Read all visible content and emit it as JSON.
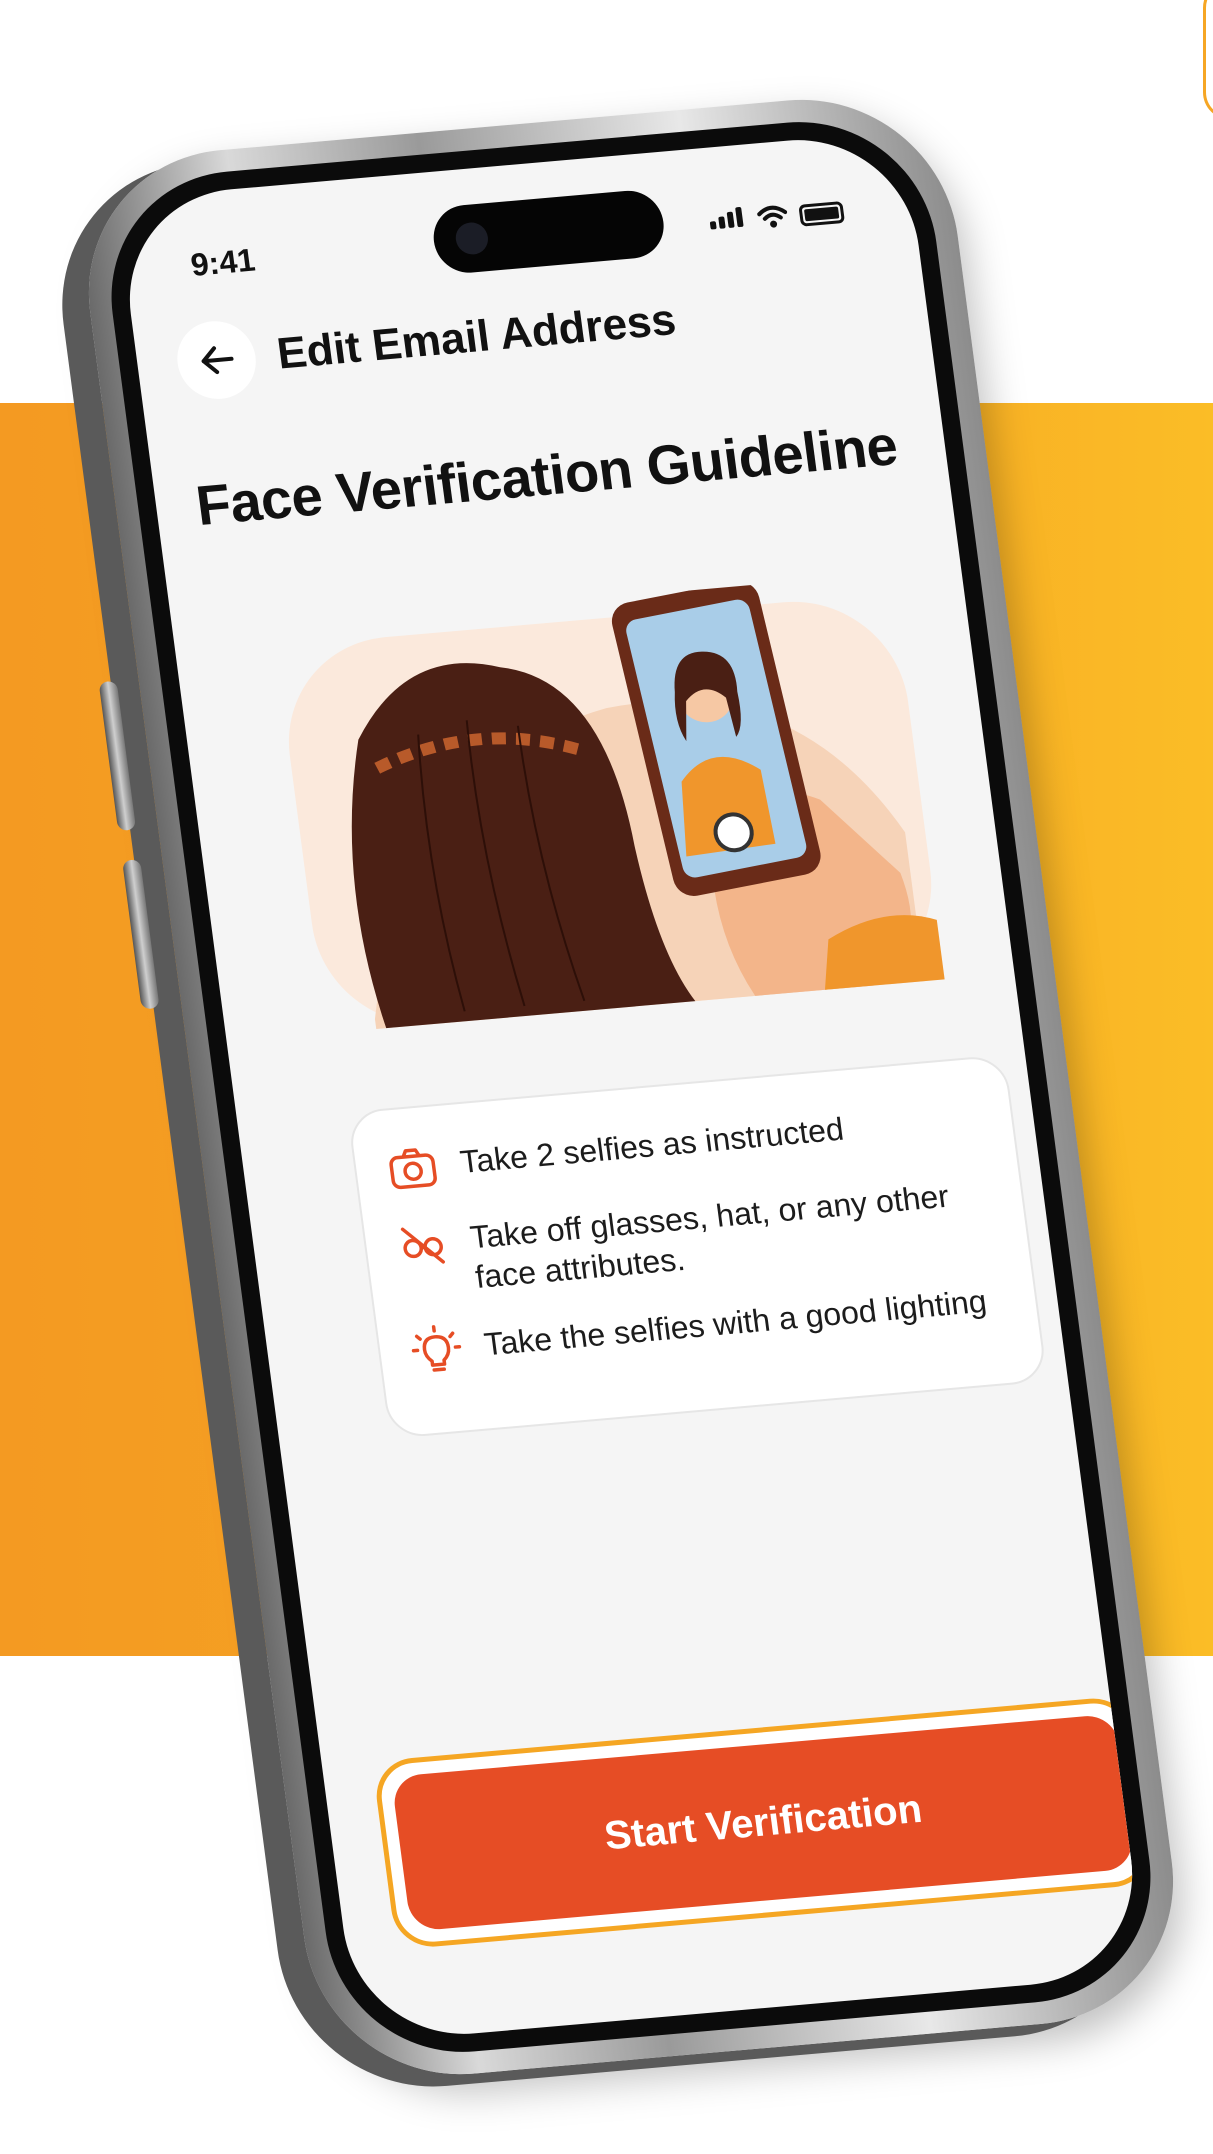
{
  "status_bar": {
    "time": "9:41"
  },
  "header": {
    "title": "Edit Email Address"
  },
  "page": {
    "title": "Face Verification Guideline"
  },
  "guidelines": [
    {
      "icon": "camera-icon",
      "text": "Take 2 selfies as instructed"
    },
    {
      "icon": "no-glasses-icon",
      "text": "Take off glasses, hat, or any other face attributes."
    },
    {
      "icon": "lightbulb-icon",
      "text": "Take the selfies with a good lighting"
    }
  ],
  "cta": {
    "label": "Start Verification"
  },
  "colors": {
    "accent": "#e64d25",
    "background_band": "#f6a624",
    "screen": "#f5f5f5"
  }
}
